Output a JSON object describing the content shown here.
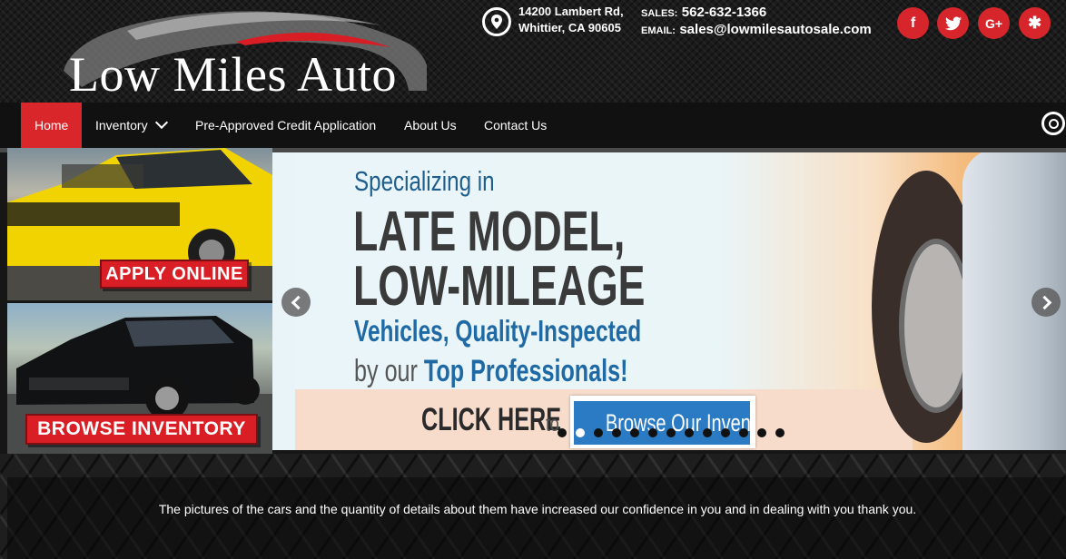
{
  "brand": {
    "name": "Low Miles Auto",
    "accent": "#d8262a"
  },
  "address": {
    "icon": "map-marker-icon",
    "line1": "14200 Lambert Rd,",
    "line2": "Whittier, CA 90605"
  },
  "contact": {
    "sales_label": "SALES:",
    "sales_value": "562-632-1366",
    "email_label": "EMAIL:",
    "email_value": "sales@lowmilesautosale.com"
  },
  "social": [
    {
      "name": "facebook",
      "glyph": "f"
    },
    {
      "name": "twitter",
      "glyph": "🐦"
    },
    {
      "name": "google-plus",
      "glyph": "G+"
    },
    {
      "name": "yelp",
      "glyph": "✱"
    }
  ],
  "nav": {
    "items": [
      "Home",
      "Inventory",
      "Pre-Approved Credit Application",
      "About Us",
      "Contact Us"
    ],
    "active": "Home"
  },
  "promos": {
    "apply": "APPLY ONLINE",
    "browse": "BROWSE INVENTORY"
  },
  "slide": {
    "line1": "Specializing in",
    "line2": "LATE MODEL,",
    "line3": "LOW-MILEAGE",
    "line4": "Vehicles, Quality-Inspected",
    "line5a": "by our",
    "line5b": "Top Professionals!",
    "cta": "CLICK HERE",
    "cta_to": "to",
    "cta_button": "Browse Our Inventory!"
  },
  "slider": {
    "total_slides": 13,
    "active_index": 1
  },
  "testimonial": {
    "text": "The pictures of the cars and the quantity of details about them have increased our confidence in you and in dealing with you thank you."
  }
}
